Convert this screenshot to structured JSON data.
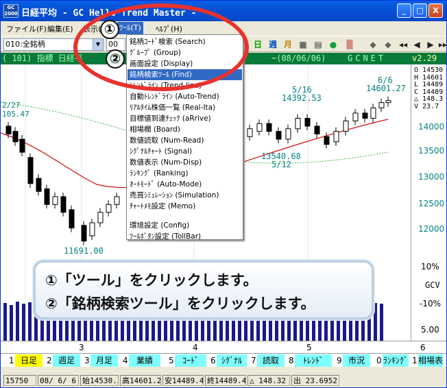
{
  "window": {
    "app_icon_text": "GC 2000",
    "title": "日経平均 - GC Hello Trend Master -",
    "min_label": "_",
    "max_label": "□",
    "close_label": "X"
  },
  "menubar": [
    {
      "label": "ファイル(F)"
    },
    {
      "label": "編集(E)"
    },
    {
      "label": "表示(V)"
    },
    {
      "label": "ﾂｰﾙ(T)"
    },
    {
      "label": "ﾍﾙﾌﾟ(H)"
    }
  ],
  "toolbar": {
    "stock_combo": "010:全銘柄",
    "second_combo": "00",
    "combo_arrow": "▼",
    "icons": [
      {
        "name": "day-icon",
        "glyph": "日",
        "color": "#00a000"
      },
      {
        "name": "week-icon",
        "glyph": "週",
        "color": "#0050c0"
      },
      {
        "name": "month-icon",
        "glyph": "月",
        "color": "#c08000"
      },
      {
        "name": "chart-icon-1",
        "glyph": "▦",
        "color": "#303030"
      },
      {
        "name": "chart-icon-2",
        "glyph": "▤",
        "color": "#303030"
      },
      {
        "name": "globe-icon",
        "glyph": "●",
        "color": "#10a040"
      },
      {
        "name": "pattern-icon",
        "glyph": "▒",
        "color": "#c03030"
      },
      {
        "name": "prev-icon",
        "glyph": "◆",
        "color": "#606060"
      },
      {
        "name": "next-icon",
        "glyph": "◆",
        "color": "#606060"
      },
      {
        "name": "rewind-icon",
        "glyph": "◀◀",
        "color": "#202020"
      },
      {
        "name": "back-icon",
        "glyph": "◀",
        "color": "#202020"
      },
      {
        "name": "forward-icon",
        "glyph": "▶",
        "color": "#202020"
      },
      {
        "name": "fast-forward-icon",
        "glyph": "▶▶",
        "color": "#202020"
      }
    ]
  },
  "infobar": {
    "left": "(  101)  指標  日経平",
    "date": "~(08/06/06)",
    "brand": "GCNET",
    "version": "v2.29"
  },
  "chart": {
    "labels": {
      "top_left_date": "2/27",
      "top_left_val": "105.47",
      "peak_date": "5/16",
      "peak_val": "14392.53",
      "trough_val": "13540.68",
      "trough_date": "5/12",
      "last_date": "6/6",
      "last_val": "14601.27",
      "low_val": "11691.00"
    },
    "right_axis": {
      "ohlc": [
        "O 14530",
        "H 14601",
        "L 14489",
        "C 14489",
        "△ 148.3",
        "V 23.7"
      ],
      "prices": [
        "14000",
        "13500",
        "13000",
        "12500",
        "12000"
      ],
      "pct": [
        "10%",
        "GCV",
        "-10%",
        "5.00"
      ]
    },
    "x_labels": [
      "3",
      "4",
      "5",
      "6"
    ]
  },
  "bottom_tabs": [
    {
      "num": "1",
      "label": "日足",
      "bg": "#ffff00"
    },
    {
      "num": "2",
      "label": "週足",
      "bg": "#7fffff"
    },
    {
      "num": "3",
      "label": "月足",
      "bg": "#7fffff"
    },
    {
      "num": "4",
      "label": "業績",
      "bg": "#7fffff"
    },
    {
      "num": "5",
      "label": "ｺｰﾄﾞ",
      "bg": "#7fffff"
    },
    {
      "num": "6",
      "label": "ｼｸﾞﾅﾙ",
      "bg": "#7fffff"
    },
    {
      "num": "7",
      "label": "読取",
      "bg": "#7fffff"
    },
    {
      "num": "8",
      "label": "ﾄﾚﾝﾄﾞ",
      "bg": "#7fffff"
    },
    {
      "num": "9",
      "label": "市況",
      "bg": "#7fffff"
    },
    {
      "num": "0",
      "label": "ﾗﾝｷﾝｸﾞ",
      "bg": "#7fffff"
    },
    {
      "num": "1",
      "label": "相場表",
      "bg": "#7fffff"
    }
  ],
  "status": [
    "15750",
    "08/ 6/ 6",
    "始14530.36",
    "高14601.27",
    "安14489.44",
    "終14489.44",
    "△  148.32",
    "出   23.6952"
  ],
  "tools_menu": [
    {
      "label": "銘柄ｺｰﾄﾞ検索 (Search)"
    },
    {
      "label": "ｸﾞﾙｰﾌﾟ (Group)"
    },
    {
      "label": "画面設定 (Display)"
    },
    {
      "label": "銘柄検索ﾂｰﾙ (Find)"
    },
    {
      "label": "ﾄﾚﾝﾄﾞﾗｲﾝ (Trend-line)"
    },
    {
      "label": "自動ﾄﾚﾝﾄﾞﾗｲﾝ (Auto-Trend)"
    },
    {
      "label": "ﾘｱﾙﾀｲﾑ株価一覧 (Real-Ita)"
    },
    {
      "label": "目標値到達ﾁｪｯｸ (aRrive)"
    },
    {
      "label": "相場欄 (Board)"
    },
    {
      "label": "数値読取 (Num-Read)"
    },
    {
      "label": "ｼｸﾞﾅﾙﾁｬｰﾄ (Signal)"
    },
    {
      "label": "数値表示 (Num-Disp)"
    },
    {
      "label": "ﾗﾝｷﾝｸﾞ (Ranking)"
    },
    {
      "label": "ｵｰﾄﾓｰﾄﾞ (Auto-Mode)"
    },
    {
      "label": "売買ｼﾐｭﾚｰｼｮﾝ (Simulation)"
    },
    {
      "label": "ﾁｬｰﾄﾒﾓ設定 (Memo)"
    },
    {
      "label": "環境設定 (Config)"
    },
    {
      "label": "ﾂｰﾙﾎﾞﾀﾝ設定 (TollBar)"
    }
  ],
  "annotations": {
    "step1_marker": "①",
    "step2_marker": "②",
    "line1": "①「ツール」をクリックします。",
    "line2": "②「銘柄検索ツール」をクリックします。"
  },
  "candles": [
    {
      "o": 14000,
      "c": 13850
    },
    {
      "o": 13900,
      "c": 13700
    },
    {
      "o": 13750,
      "c": 13500
    },
    {
      "o": 13400,
      "c": 12900
    },
    {
      "o": 13000,
      "c": 12750
    },
    {
      "o": 12800,
      "c": 12500
    },
    {
      "o": 12500,
      "c": 12650
    },
    {
      "o": 12650,
      "c": 12350
    },
    {
      "o": 12400,
      "c": 12050
    },
    {
      "o": 12100,
      "c": 11800
    },
    {
      "o": 11900,
      "c": 12150
    },
    {
      "o": 12150,
      "c": 12350
    },
    {
      "o": 12350,
      "c": 12500
    },
    {
      "o": 12500,
      "c": 12650
    },
    {
      "o": 13800,
      "c": 13950
    },
    {
      "o": 13900,
      "c": 14050
    },
    {
      "o": 14050,
      "c": 13900
    },
    {
      "o": 13900,
      "c": 13750
    },
    {
      "o": 13750,
      "c": 13950
    },
    {
      "o": 13950,
      "c": 14150
    },
    {
      "o": 14150,
      "c": 14000
    },
    {
      "o": 14000,
      "c": 13850
    },
    {
      "o": 13800,
      "c": 13650
    },
    {
      "o": 13700,
      "c": 13900
    },
    {
      "o": 13900,
      "c": 14100
    },
    {
      "o": 14100,
      "c": 14250
    },
    {
      "o": 14250,
      "c": 14150
    },
    {
      "o": 14150,
      "c": 14350
    },
    {
      "o": 14350,
      "c": 14450
    },
    {
      "o": 14450,
      "c": 14489
    }
  ],
  "volume_bars": [
    55,
    52,
    57,
    54,
    56,
    53,
    58,
    55,
    57,
    56,
    54,
    57,
    55,
    56,
    58,
    55,
    57,
    54,
    56,
    55,
    57,
    53,
    56,
    58,
    55,
    57,
    54,
    56,
    55,
    57,
    56,
    54,
    57,
    55,
    56,
    58,
    57,
    55,
    56,
    57,
    55,
    56,
    58,
    54,
    57,
    56,
    55,
    57,
    56,
    54,
    55,
    56,
    57,
    55,
    56,
    54,
    58,
    55,
    57,
    56,
    55,
    54
  ]
}
